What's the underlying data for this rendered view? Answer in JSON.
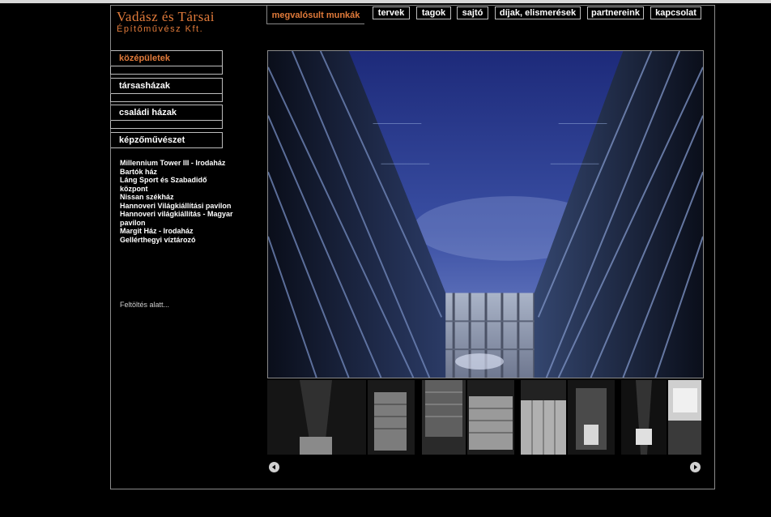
{
  "brand": {
    "line1": "Vadász  és  Társai",
    "line2": "Építőművész Kft."
  },
  "nav": {
    "active_label": "megvalósult munkák",
    "items": [
      {
        "label": "tervek"
      },
      {
        "label": "tagok"
      },
      {
        "label": "sajtó"
      },
      {
        "label": "díjak, elismerések"
      },
      {
        "label": "partnereink"
      },
      {
        "label": "kapcsolat"
      }
    ]
  },
  "categories": [
    {
      "label": "középületek",
      "active": true
    },
    {
      "label": "társasházak",
      "active": false
    },
    {
      "label": "családi házak",
      "active": false
    },
    {
      "label": "képzőművészet",
      "active": false
    }
  ],
  "projects": [
    "Millennium Tower III - Irodaház",
    "Bartók ház",
    "Láng Sport és Szabadidő központ",
    "Nissan székház",
    "Hannoveri Világkiállítási pavilon",
    "Hannoveri világkiállítás - Magyar pavilon",
    "Margit Ház - Irodaház",
    "Gellérthegyi víztározó"
  ],
  "status": {
    "loading": "Feltöltés alatt..."
  },
  "icons": {
    "prev": "arrow-left-circle-icon",
    "next": "arrow-right-circle-icon"
  },
  "colors": {
    "background": "#000000",
    "accent": "#e07a3a",
    "border": "#bdbdbd",
    "text": "#ffffff"
  }
}
